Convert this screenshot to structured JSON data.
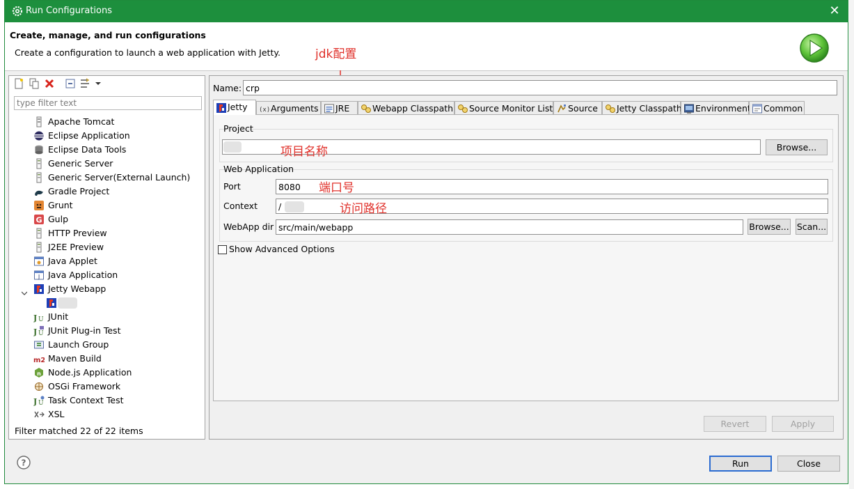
{
  "window": {
    "title": "Run Configurations",
    "close_symbol": "✕",
    "icon": "gear-icon"
  },
  "header": {
    "title": "Create, manage, and run configurations",
    "description": "Create a configuration to launch a web application with Jetty.",
    "icon": "run-icon"
  },
  "annotations": {
    "jdk": "jdk配置",
    "project_name": "项目名称",
    "port": "端口号",
    "context": "访问路径",
    "color": "#e0302a"
  },
  "left": {
    "filter_placeholder": "type filter text",
    "status": "Filter matched 22 of 22 items",
    "toolbar": [
      "new-config-icon",
      "duplicate-icon",
      "delete-icon",
      "collapse-all-icon",
      "filter-icon",
      "dropdown-arrow-icon"
    ],
    "tree": [
      {
        "label": "Apache Tomcat",
        "icon": "tomcat-icon"
      },
      {
        "label": "Eclipse Application",
        "icon": "eclipse-icon"
      },
      {
        "label": "Eclipse Data Tools",
        "icon": "database-icon"
      },
      {
        "label": "Generic Server",
        "icon": "server-icon"
      },
      {
        "label": "Generic Server(External Launch)",
        "icon": "server-icon"
      },
      {
        "label": "Gradle Project",
        "icon": "gradle-icon"
      },
      {
        "label": "Grunt",
        "icon": "grunt-icon"
      },
      {
        "label": "Gulp",
        "icon": "gulp-icon"
      },
      {
        "label": "HTTP Preview",
        "icon": "server-icon"
      },
      {
        "label": "J2EE Preview",
        "icon": "server-icon"
      },
      {
        "label": "Java Applet",
        "icon": "applet-icon"
      },
      {
        "label": "Java Application",
        "icon": "java-app-icon"
      },
      {
        "label": "Jetty Webapp",
        "icon": "jetty-icon",
        "expanded": true
      },
      {
        "label": "",
        "icon": "jetty-icon",
        "child": true,
        "selected": true
      },
      {
        "label": "JUnit",
        "icon": "junit-icon"
      },
      {
        "label": "JUnit Plug-in Test",
        "icon": "junit-plugin-icon"
      },
      {
        "label": "Launch Group",
        "icon": "launch-group-icon"
      },
      {
        "label": "Maven Build",
        "icon": "maven-icon"
      },
      {
        "label": "Node.js Application",
        "icon": "nodejs-icon"
      },
      {
        "label": "OSGi Framework",
        "icon": "osgi-icon"
      },
      {
        "label": "Task Context Test",
        "icon": "task-icon"
      },
      {
        "label": "XSL",
        "icon": "xsl-icon"
      }
    ]
  },
  "config": {
    "name_label": "Name:",
    "name_value": "crp",
    "tabs": [
      {
        "label": "Jetty",
        "icon": "jetty-icon",
        "active": true
      },
      {
        "label": "Arguments",
        "icon": "arguments-icon"
      },
      {
        "label": "JRE",
        "icon": "jre-icon"
      },
      {
        "label": "Webapp Classpath",
        "icon": "classpath-icon"
      },
      {
        "label": "Source Monitor List",
        "icon": "classpath-icon"
      },
      {
        "label": "Source",
        "icon": "source-icon"
      },
      {
        "label": "Jetty Classpath",
        "icon": "classpath-icon"
      },
      {
        "label": "Environment",
        "icon": "environment-icon"
      },
      {
        "label": "Common",
        "icon": "common-icon"
      }
    ],
    "project_group": "Project",
    "project_value": "",
    "browse_label": "Browse...",
    "webapp_group": "Web Application",
    "port_label": "Port",
    "port_value": "8080",
    "context_label": "Context",
    "context_value": "/",
    "webapp_dir_label": "WebApp dir",
    "webapp_dir_value": "src/main/webapp",
    "browse2_label": "Browse...",
    "scan_label": "Scan...",
    "advanced_label": "Show Advanced Options"
  },
  "buttons": {
    "revert": "Revert",
    "apply": "Apply",
    "run": "Run",
    "close": "Close"
  }
}
